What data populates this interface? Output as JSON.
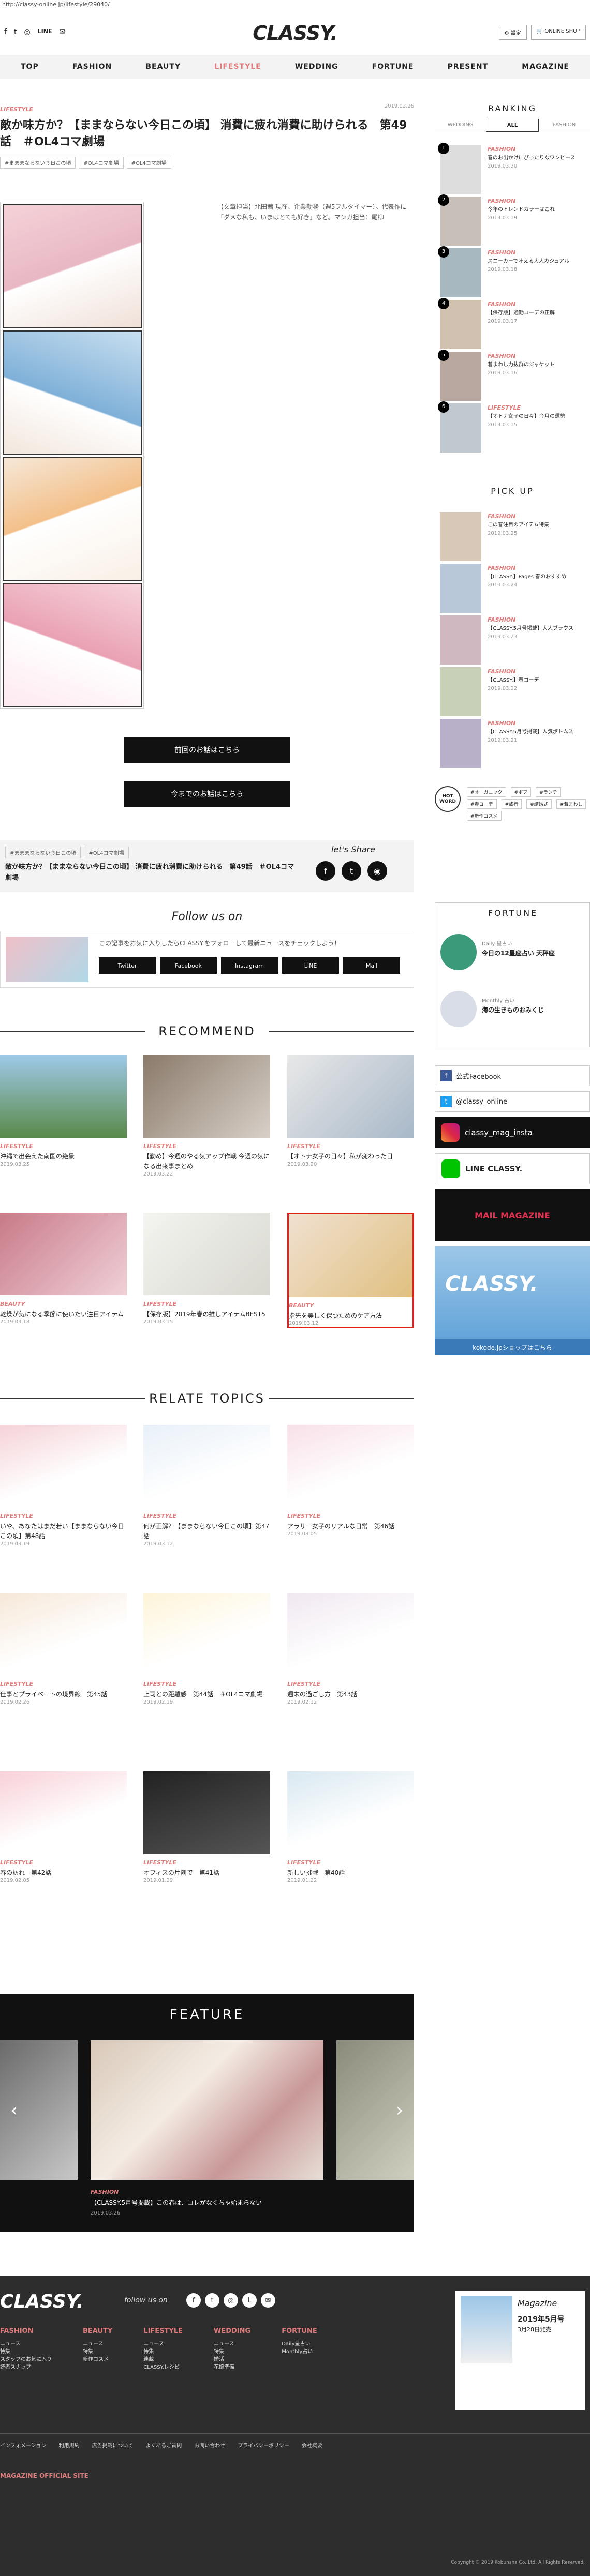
{
  "url": "http://classy-online.jp/lifestyle/29040/",
  "header": {
    "logo": "CLASSY.",
    "settings_label": "設定",
    "online_shop": "ONLINE SHOP"
  },
  "nav": {
    "items": [
      "TOP",
      "FASHION",
      "BEAUTY",
      "LIFESTYLE",
      "WEDDING",
      "FORTUNE",
      "PRESENT",
      "MAGAZINE"
    ]
  },
  "article": {
    "category": "LIFESTYLE",
    "date": "2019.03.26",
    "title": "敵か味方か？【ままならない今日この頃】 消費に疲れ消費に助けられる　第49話　＃OL4コマ劇場",
    "tags": [
      "#まままならない今日この頃",
      "#OL4コマ劇場",
      "#OL4コマ劇場"
    ],
    "credit": "【文章担当】北田茜 現在、企業勤務（週5フルタイマー）。代表作に「ダメな私も、いまはとても好き」など。マンガ担当：尾柳",
    "prev_button": "前回のお話はこちら",
    "list_button": "今までのお話はこちら",
    "share_title": "敵か味方か？【ままならない今日この頃】 消費に疲れ消費に助けられる　第49話　＃OL4コマ劇場",
    "lets_share": "let's Share",
    "follow_title": "Follow us on",
    "follow_text": "この記事をお気に入りしたらCLASSY.をフォローして最新ニュースをチェックしよう！",
    "follow_buttons": [
      "Twitter",
      "Facebook",
      "Instagram",
      "LINE",
      "Mail"
    ]
  },
  "recommend": {
    "title": "RECOMMEND",
    "items": [
      {
        "cat": "LIFESTYLE",
        "text": "沖縄で出会えた南国の絶景",
        "date": "2019.03.25"
      },
      {
        "cat": "LIFESTYLE",
        "text": "【勤め】今週のやる気アップ作戦 今週の気になる出来事まとめ",
        "date": "2019.03.22"
      },
      {
        "cat": "LIFESTYLE",
        "text": "【オトナ女子の日々】私が変わった日",
        "date": "2019.03.20"
      },
      {
        "cat": "BEAUTY",
        "text": "乾燥が気になる季節に使いたい注目アイテム",
        "date": "2019.03.18"
      },
      {
        "cat": "LIFESTYLE",
        "text": "【保存版】2019年春の推しアイテムBEST5",
        "date": "2019.03.15"
      },
      {
        "cat": "BEAUTY",
        "text": "指先を美しく保つためのケア方法",
        "date": "2019.03.12"
      }
    ]
  },
  "relate": {
    "title": "RELATE TOPICS",
    "items": [
      {
        "cat": "LIFESTYLE",
        "text": "いや、あなたはまだ若い【ままならない今日この頃】第48話",
        "date": "2019.03.19"
      },
      {
        "cat": "LIFESTYLE",
        "text": "何が正解？【ままならない今日この頃】第47話",
        "date": "2019.03.12"
      },
      {
        "cat": "LIFESTYLE",
        "text": "アラサー女子のリアルな日常　第46話",
        "date": "2019.03.05"
      },
      {
        "cat": "LIFESTYLE",
        "text": "仕事とプライベートの境界線　第45話",
        "date": "2019.02.26"
      },
      {
        "cat": "LIFESTYLE",
        "text": "上司との距離感　第44話　＃OL4コマ劇場",
        "date": "2019.02.19"
      },
      {
        "cat": "LIFESTYLE",
        "text": "週末の過ごし方　第43話",
        "date": "2019.02.12"
      },
      {
        "cat": "LIFESTYLE",
        "text": "春の訪れ　第42話",
        "date": "2019.02.05"
      },
      {
        "cat": "LIFESTYLE",
        "text": "オフィスの片隅で　第41話",
        "date": "2019.01.29"
      },
      {
        "cat": "LIFESTYLE",
        "text": "新しい挑戦　第40話",
        "date": "2019.01.22"
      }
    ]
  },
  "feature": {
    "title": "FEATURE",
    "cat": "FASHION",
    "date": "2019.03.26",
    "text": "【CLASSY.5月号掲載】この春は、コレがなくちゃ始まらない"
  },
  "sidebar": {
    "ranking_title": "RANKING",
    "ranking_tabs": [
      "WEDDING",
      "ALL",
      "FASHION"
    ],
    "ranking": [
      {
        "n": "1",
        "cat": "FASHION",
        "text": "春のお出かけにぴったりなワンピース",
        "date": "2019.03.20"
      },
      {
        "n": "2",
        "cat": "FASHION",
        "text": "今年のトレンドカラーはこれ",
        "date": "2019.03.19"
      },
      {
        "n": "3",
        "cat": "FASHION",
        "text": "スニーカーで叶える大人カジュアル",
        "date": "2019.03.18"
      },
      {
        "n": "4",
        "cat": "FASHION",
        "text": "【保存版】通勤コーデの正解",
        "date": "2019.03.17"
      },
      {
        "n": "5",
        "cat": "FASHION",
        "text": "着まわし力抜群のジャケット",
        "date": "2019.03.16"
      },
      {
        "n": "6",
        "cat": "LIFESTYLE",
        "text": "【オトナ女子の日々】今月の運勢",
        "date": "2019.03.15"
      }
    ],
    "pickup_title": "PICK UP",
    "pickup": [
      {
        "cat": "FASHION",
        "text": "この春注目のアイテム特集",
        "date": "2019.03.25"
      },
      {
        "cat": "FASHION",
        "text": "【CLASSY.】Pages 春のおすすめ",
        "date": "2019.03.24"
      },
      {
        "cat": "FASHION",
        "text": "【CLASSY.5月号掲載】大人ブラウス",
        "date": "2019.03.23"
      },
      {
        "cat": "FASHION",
        "text": "【CLASSY.】春コーデ",
        "date": "2019.03.22"
      },
      {
        "cat": "FASHION",
        "text": "【CLASSY.5月号掲載】人気ボトムス",
        "date": "2019.03.21"
      }
    ],
    "hotword": "HOT WORD",
    "hotwords": [
      "#オーガニック",
      "#ボブ",
      "#ランチ",
      "#春コーデ",
      "#旅行",
      "#結婚式",
      "#着まわし",
      "#新作コスメ"
    ],
    "fortune_title": "FORTUNE",
    "fortune": [
      {
        "label": "Daily 星占い",
        "text": "今日の12星座占い 天秤座"
      },
      {
        "label": "Monthly 占い",
        "text": "海の生きものおみくじ"
      }
    ],
    "facebook": "公式Facebook",
    "twitter": "@classy_online",
    "instagram": "classy_mag_insta",
    "line": "LINE CLASSY.",
    "mail": "MAIL MAGAZINE",
    "kokode": "kokode.jpショップはこちら"
  },
  "footer": {
    "logo": "CLASSY.",
    "follow": "follow us on",
    "cols": [
      {
        "h": "FASHION",
        "items": [
          "ニュース",
          "特集",
          "スタッフのお気に入り",
          "読者スナップ"
        ]
      },
      {
        "h": "BEAUTY",
        "items": [
          "ニュース",
          "特集",
          "新作コスメ"
        ]
      },
      {
        "h": "LIFESTYLE",
        "items": [
          "ニュース",
          "特集",
          "連載",
          "CLASSY.レシピ"
        ]
      },
      {
        "h": "WEDDING",
        "items": [
          "ニュース",
          "特集",
          "婚活",
          "花嫁準備"
        ]
      },
      {
        "h": "FORTUNE",
        "items": [
          "Daily星占い",
          "Monthly占い"
        ]
      }
    ],
    "magazine": "Magazine",
    "issue": "2019年5月号",
    "release": "3月28日発売",
    "bottom_links": [
      "インフォメーション",
      "利用規約",
      "広告掲載について",
      "よくあるご質問",
      "お問い合わせ",
      "プライバシーポリシー",
      "会社概要"
    ],
    "official": "MAGAZINE OFFICIAL SITE",
    "copyright": "Copyright © 2019 Kobunsha Co.,Ltd. All Rights Reserved."
  }
}
